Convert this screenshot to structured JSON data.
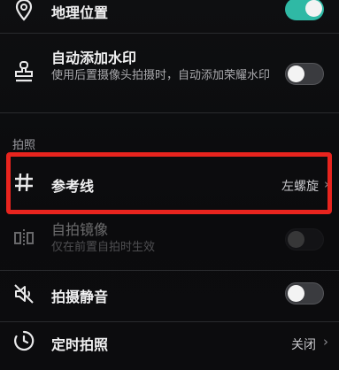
{
  "settings": {
    "location": {
      "title": "地理位置",
      "icon": "location-pin-icon",
      "enabled": true
    },
    "watermark": {
      "title": "自动添加水印",
      "subtitle": "使用后置摄像头拍摄时，自动添加荣耀水印",
      "icon": "stamp-icon",
      "enabled": false
    },
    "section_shooting": {
      "header": "拍照"
    },
    "gridlines": {
      "title": "参考线",
      "value": "左螺旋",
      "icon": "grid-hash-icon"
    },
    "mirror": {
      "title": "自拍镜像",
      "subtitle": "仅在前置自拍时生效",
      "icon": "mirror-icon",
      "enabled": false,
      "disabled": true
    },
    "mute": {
      "title": "拍摄静音",
      "icon": "mute-speaker-icon",
      "enabled": false
    },
    "timer": {
      "title": "定时拍照",
      "value": "关闭",
      "icon": "timer-icon"
    }
  },
  "colors": {
    "accent": "#2fb9a5",
    "highlight": "#e8241e",
    "background": "#0b0b0d"
  }
}
